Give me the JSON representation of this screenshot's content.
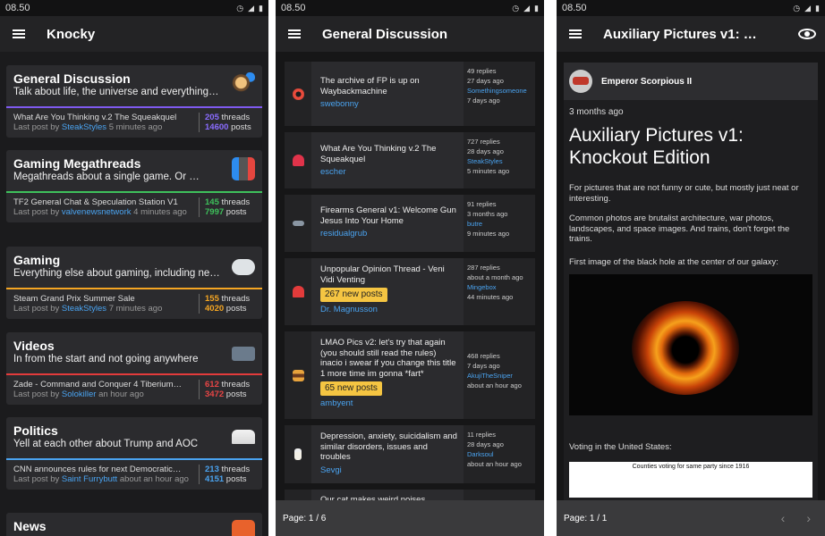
{
  "status": {
    "time": "08.50"
  },
  "panel1": {
    "title": "Knocky",
    "subforums": [
      {
        "name": "General Discussion",
        "desc": "Talk about life, the universe and everything …",
        "color": "#7f5af0",
        "icon": "person-chat-icon",
        "last_thread": "What Are You Thinking v.2 The Squeakquel",
        "last_by_prefix": "Last post by",
        "last_user": "SteakStyles",
        "last_time": "5 minutes ago",
        "threads": "205",
        "threads_label": "threads",
        "posts": "14600",
        "posts_label": "posts"
      },
      {
        "name": "Gaming Megathreads",
        "desc": "Megathreads about a single game. Or …",
        "color": "#3ec15b",
        "icon": "switch-console-icon",
        "last_thread": "TF2 General Chat & Speculation Station V1",
        "last_by_prefix": "Last post by",
        "last_user": "valvenewsnetwork",
        "last_time": "4 minutes ago",
        "threads": "145",
        "threads_label": "threads",
        "posts": "7997",
        "posts_label": "posts"
      },
      {
        "name": "Gaming",
        "desc": "Everything else about gaming, including new…",
        "color": "#f5a623",
        "icon": "gamepad-icon",
        "last_thread": "Steam Grand Prix Summer Sale",
        "last_by_prefix": "Last post by",
        "last_user": "SteakStyles",
        "last_time": "7 minutes ago",
        "threads": "155",
        "threads_label": "threads",
        "posts": "4020",
        "posts_label": "posts"
      },
      {
        "name": "Videos",
        "desc": "In from the start and not going anywhere",
        "color": "#e23b3b",
        "icon": "video-camera-icon",
        "last_thread": "Zade - Command and Conquer 4 Tiberium…",
        "last_by_prefix": "Last post by",
        "last_user": "Solokiller",
        "last_time": "an hour ago",
        "threads": "612",
        "threads_label": "threads",
        "posts": "3472",
        "posts_label": "posts"
      },
      {
        "name": "Politics",
        "desc": "Yell at each other about Trump and AOC",
        "color": "#4aa3f0",
        "icon": "capitol-building-icon",
        "last_thread": "CNN announces rules for next Democratic…",
        "last_by_prefix": "Last post by",
        "last_user": "Saint Furrybutt",
        "last_time": "about an hour ago",
        "threads": "213",
        "threads_label": "threads",
        "posts": "4151",
        "posts_label": "posts"
      },
      {
        "name": "News",
        "icon": "newspaper-icon"
      }
    ]
  },
  "panel2": {
    "title": "General Discussion",
    "threads": [
      {
        "icon": "lifebuoy-icon",
        "title": "The archive of FP is up on Waybackmachine",
        "author": "swebonny",
        "replies": "49 replies",
        "age": "27 days ago",
        "last_user": "Somethingsomeone",
        "last_time": "7 days ago"
      },
      {
        "icon": "broken-heart-icon",
        "title": "What Are You Thinking v.2 The Squeakquel",
        "author": "escher",
        "replies": "727 replies",
        "age": "28 days ago",
        "last_user": "SteakStyles",
        "last_time": "5 minutes ago"
      },
      {
        "icon": "pistol-icon",
        "title": "Firearms General v1: Welcome Gun Jesus Into Your Home",
        "author": "residualgrub",
        "replies": "91 replies",
        "age": "3 months ago",
        "last_user": "butre",
        "last_time": "9 minutes ago"
      },
      {
        "icon": "siren-icon",
        "title": "Unpopular Opinion Thread - Veni Vidi Venting",
        "new_posts": "267 new posts",
        "author": "Dr. Magnusson",
        "replies": "287 replies",
        "age": "about a month ago",
        "last_user": "Mingebox",
        "last_time": "44 minutes ago"
      },
      {
        "icon": "burger-icon",
        "title": "LMAO Pics v2: let's try that again (you should still read the rules) inacio i swear if you change this title 1 more time im gonna *fart*",
        "new_posts": "65 new posts",
        "author": "ambyent",
        "replies": "468 replies",
        "age": "7 days ago",
        "last_user": "AkujiTheSniper",
        "last_time": "about an hour ago"
      },
      {
        "icon": "pill-bottle-icon",
        "title": "Depression, anxiety, suicidalism and similar disorders, issues and troubles",
        "author": "Sevgi",
        "replies": "11 replies",
        "age": "28 days ago",
        "last_user": "Darksoul",
        "last_time": "about an hour ago"
      },
      {
        "title": "Our cat makes weird noises"
      }
    ],
    "page": "Page: 1 / 6"
  },
  "panel3": {
    "title": "Auxiliary Pictures v1: …",
    "author": "Emperor Scorpious II",
    "time": "3 months ago",
    "post_title": "Auxiliary Pictures v1: Knockout Edition",
    "p1": "For pictures that are not funny or cute, but mostly just neat or interesting.",
    "p2": "Common photos are brutalist architecture, war photos, landscapes, and space images. And trains, don't forget the trains.",
    "p3": "First image of the black hole at the center of our galaxy:",
    "p4": "Voting in the United States:",
    "image_caption": "Counties voting for same party since 1916",
    "page": "Page: 1 / 1"
  }
}
